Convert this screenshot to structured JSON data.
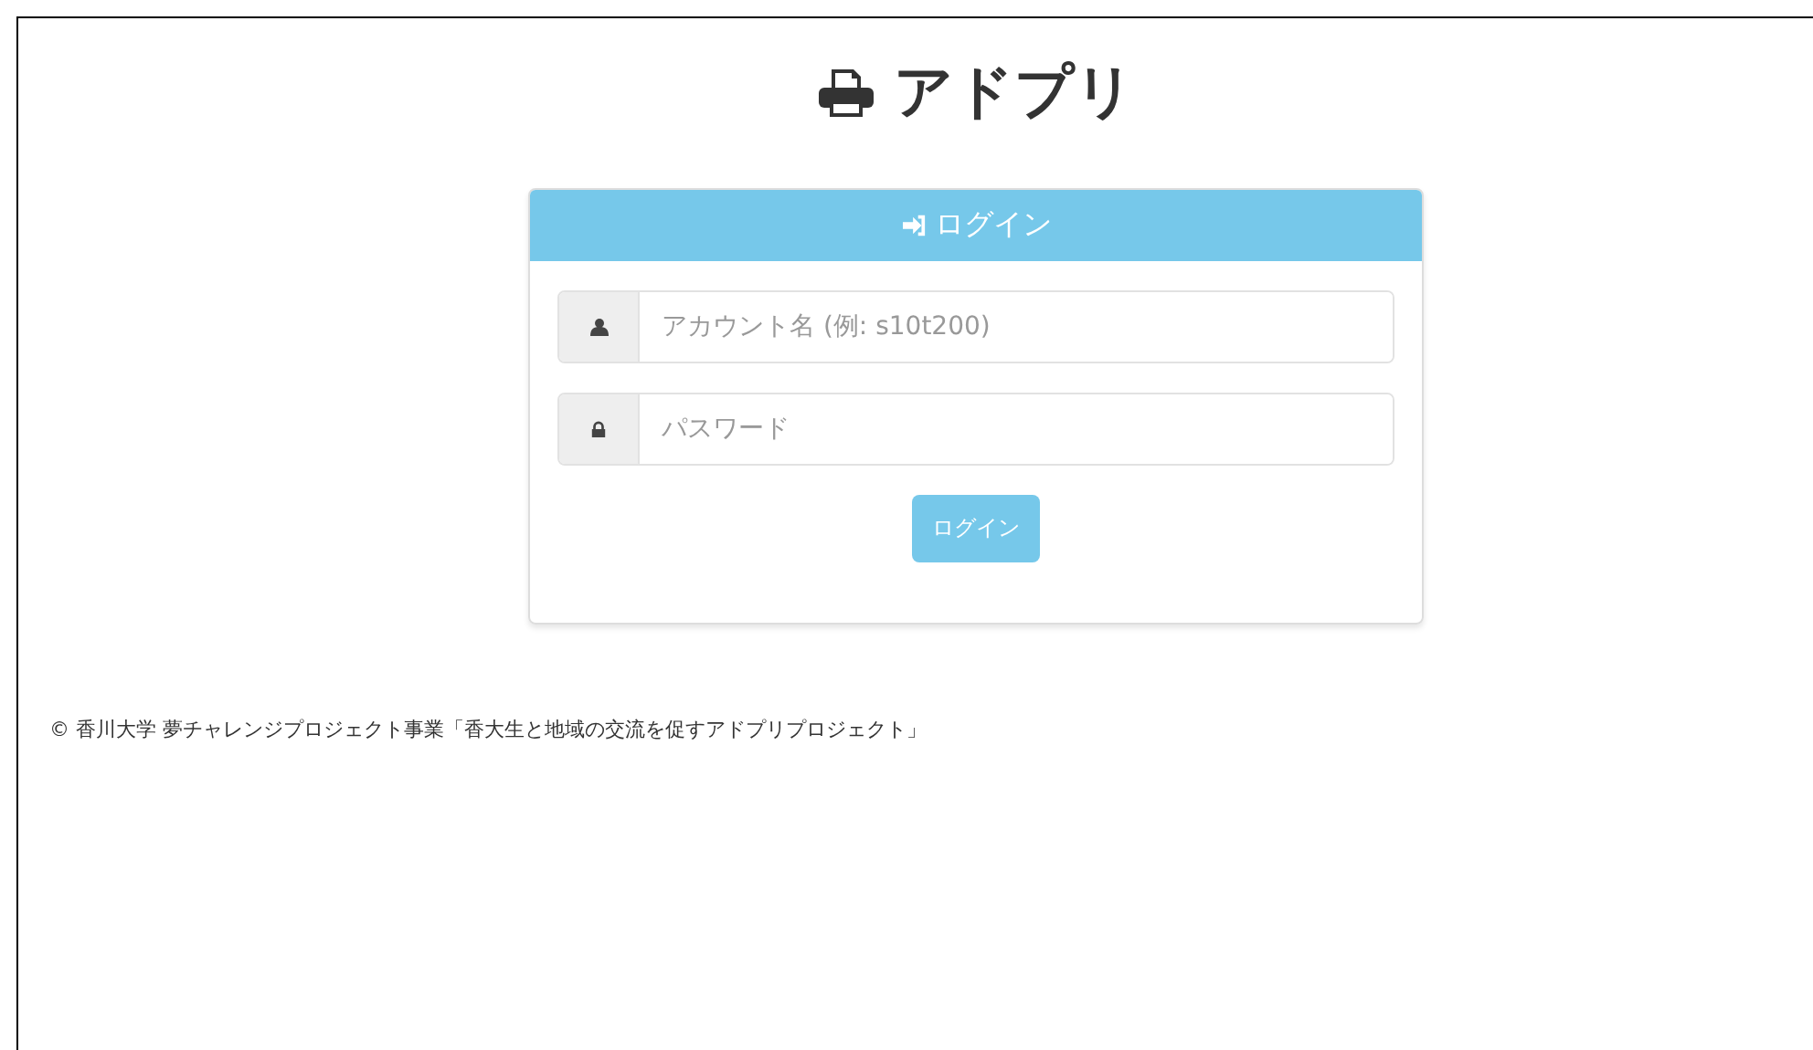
{
  "brand": {
    "title": "アドプリ"
  },
  "panel": {
    "heading": "ログイン"
  },
  "fields": [
    {
      "kind": "user",
      "placeholder": "アカウント名 (例: s10t200)"
    },
    {
      "kind": "lock",
      "placeholder": "パスワード"
    }
  ],
  "submit": {
    "label": "ログイン"
  },
  "footer": {
    "text": "© 香川大学 夢チャレンジプロジェクト事業「香大生と地域の交流を促すアドプリプロジェクト」"
  }
}
